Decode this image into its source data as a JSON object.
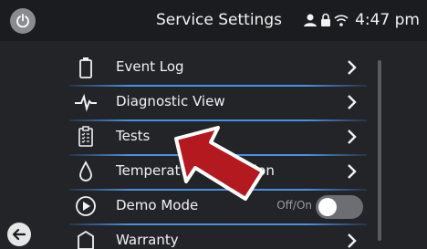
{
  "header": {
    "title": "Service Settings",
    "time": "4:47 pm",
    "status_icons": [
      "user-icon",
      "lock-icon",
      "wifi-icon"
    ]
  },
  "menu": {
    "items": [
      {
        "label": "Event Log",
        "icon": "battery-icon"
      },
      {
        "label": "Diagnostic View",
        "icon": "heartbeat-icon"
      },
      {
        "label": "Tests",
        "icon": "clipboard-icon"
      },
      {
        "label": "Temperature Calibration",
        "icon": "drop-icon",
        "visible_parts": [
          "Temperat",
          "ion"
        ]
      },
      {
        "label": "Demo Mode",
        "icon": "play-circle-icon",
        "toggle_label": "Off/On",
        "toggle_state": "off"
      },
      {
        "label": "Warranty",
        "icon": "tag-icon"
      }
    ]
  },
  "colors": {
    "accent": "#4a90e2",
    "background": "#222428",
    "header": "#1b1c1f",
    "callout_arrow": "#b3191e"
  }
}
